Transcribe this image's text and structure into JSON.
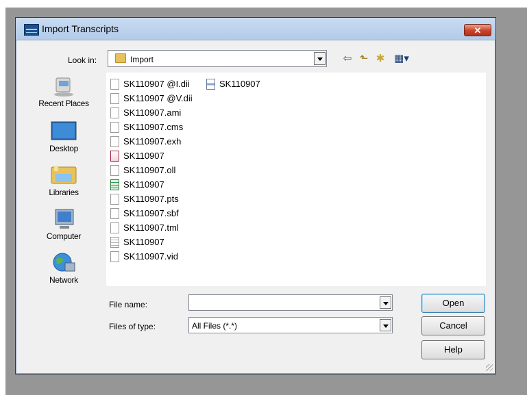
{
  "dialog": {
    "title": "Import Transcripts",
    "close_glyph": "✕"
  },
  "lookin": {
    "label": "Look in:",
    "value": "Import",
    "folder_icon": "folder-icon"
  },
  "toolbar": {
    "back_glyph": "⇦",
    "up_glyph": "⬑",
    "newfolder_glyph": "✱",
    "views_glyph": "▦▾"
  },
  "places": [
    {
      "label": "Recent Places",
      "icon": "recent-places-icon"
    },
    {
      "label": "Desktop",
      "icon": "desktop-icon"
    },
    {
      "label": "Libraries",
      "icon": "libraries-icon"
    },
    {
      "label": "Computer",
      "icon": "computer-icon"
    },
    {
      "label": "Network",
      "icon": "network-icon"
    }
  ],
  "files": [
    {
      "name": "SK110907 @I.dii",
      "icon": "file-icon"
    },
    {
      "name": "SK110907 @V.dii",
      "icon": "file-icon"
    },
    {
      "name": "SK110907.ami",
      "icon": "file-icon"
    },
    {
      "name": "SK110907.cms",
      "icon": "file-icon"
    },
    {
      "name": "SK110907.exh",
      "icon": "file-icon"
    },
    {
      "name": "SK110907",
      "icon": "pdf-file-icon"
    },
    {
      "name": "SK110907.oll",
      "icon": "file-icon"
    },
    {
      "name": "SK110907",
      "icon": "spreadsheet-file-icon"
    },
    {
      "name": "SK110907.pts",
      "icon": "file-icon"
    },
    {
      "name": "SK110907.sbf",
      "icon": "file-icon"
    },
    {
      "name": "SK110907.tml",
      "icon": "file-icon"
    },
    {
      "name": "SK110907",
      "icon": "text-file-icon"
    },
    {
      "name": "SK110907.vid",
      "icon": "file-icon"
    },
    {
      "name": "SK110907",
      "icon": "settings-file-icon"
    }
  ],
  "filename": {
    "label": "File name:",
    "value": ""
  },
  "filetype": {
    "label": "Files of type:",
    "value": "All Files (*.*)"
  },
  "buttons": {
    "open": "Open",
    "cancel": "Cancel",
    "help": "Help"
  },
  "colors": {
    "close_button": "#c7432a",
    "titlebar": "#b9d1ea",
    "backdrop": "#969696"
  }
}
